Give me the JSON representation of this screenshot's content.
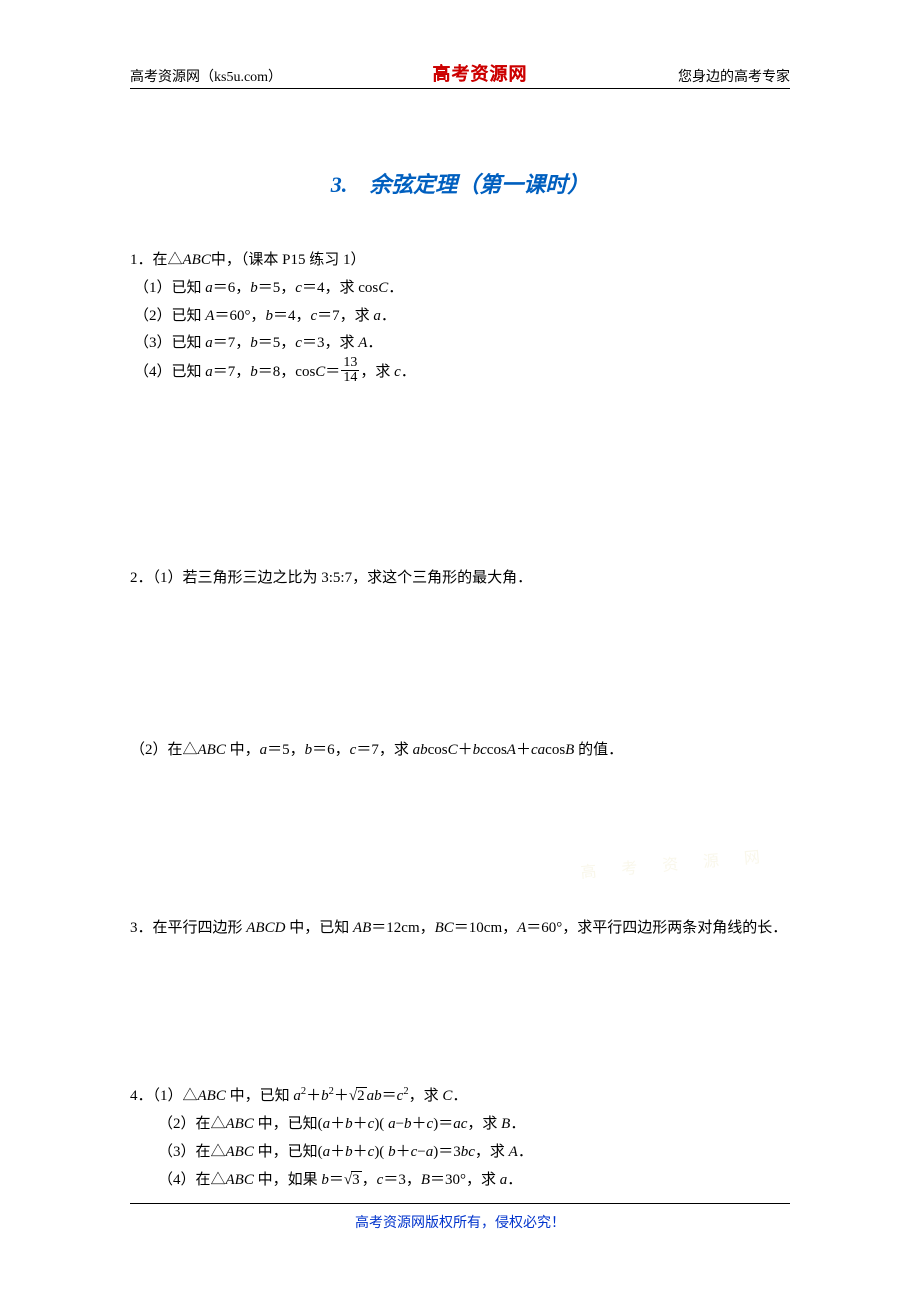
{
  "header": {
    "left": "高考资源网（ks5u.com）",
    "center": "高考资源网",
    "right": "您身边的高考专家"
  },
  "title": "3.　余弦定理（第一课时）",
  "q1": {
    "stem": "1．在△",
    "stem2": "中，（课本 P15 练习 1）",
    "s1a": "（1）已知 ",
    "s1b": "＝6，",
    "s1c": "＝5，",
    "s1d": "＝4，求 cos",
    "s1e": "．",
    "s2a": "（2）已知 ",
    "s2b": "＝60°，",
    "s2c": "＝4，",
    "s2d": "＝7，求 ",
    "s2e": "．",
    "s3a": "（3）已知 ",
    "s3b": "＝7，",
    "s3c": "＝5，",
    "s3d": "＝3，求 ",
    "s3e": "．",
    "s4a": "（4）已知 ",
    "s4b": "＝7，",
    "s4c": "＝8，cos",
    "s4d": "＝",
    "s4e": "，求 ",
    "s4f": "．",
    "frac_num": "13",
    "frac_den": "14"
  },
  "q2_1": "2．（1）若三角形三边之比为 3:5:7，求这个三角形的最大角．",
  "q2_2a": "（2）在△",
  "q2_2b": " 中，",
  "q2_2c": "＝5，",
  "q2_2d": "＝6，",
  "q2_2e": "＝7，求 ",
  "q2_2f": "cos",
  "q2_2g": "＋",
  "q2_2h": "cos",
  "q2_2i": "＋",
  "q2_2j": "cos",
  "q2_2k": " 的值．",
  "q3a": "3．在平行四边形 ",
  "q3b": " 中，已知 ",
  "q3c": "＝12cm，",
  "q3d": "＝10cm，",
  "q3e": "＝60°，求平行四边形两条对角线的长．",
  "q4": {
    "s1a": "4．（1）△",
    "s1b": " 中，已知 ",
    "s1c": "＋",
    "s1d": "＋",
    "s1sqrt": "2",
    "s1e": "＝",
    "s1f": "，求 ",
    "s1g": "．",
    "s2a": "（2）在△",
    "s2b": " 中，已知(",
    "s2c": "＋",
    "s2d": "＋",
    "s2e": ")( ",
    "s2f": "−",
    "s2g": "＋",
    "s2h": ")＝",
    "s2i": "，求 ",
    "s2j": "．",
    "s3a": "（3）在△",
    "s3b": " 中，已知(",
    "s3c": "＋",
    "s3d": "＋",
    "s3e": ")( ",
    "s3f": "＋",
    "s3g": "−",
    "s3h": ")＝3",
    "s3i": "，求 ",
    "s3j": "．",
    "s4a": "（4）在△",
    "s4b": " 中，如果 ",
    "s4c": "＝",
    "s4sqrt": "3",
    "s4d": "，",
    "s4e": "＝3，",
    "s4f": "＝30°，求 ",
    "s4g": "．"
  },
  "vars": {
    "ABC": "ABC",
    "ABCD": "ABCD",
    "AB": "AB",
    "BC": "BC",
    "A": "A",
    "B": "B",
    "C": "C",
    "a": "a",
    "b": "b",
    "c": "c",
    "ab": "ab",
    "bc": "bc",
    "ca": "ca",
    "ac": "ac"
  },
  "watermark": "高考资源网",
  "footer": "高考资源网版权所有，侵权必究！"
}
